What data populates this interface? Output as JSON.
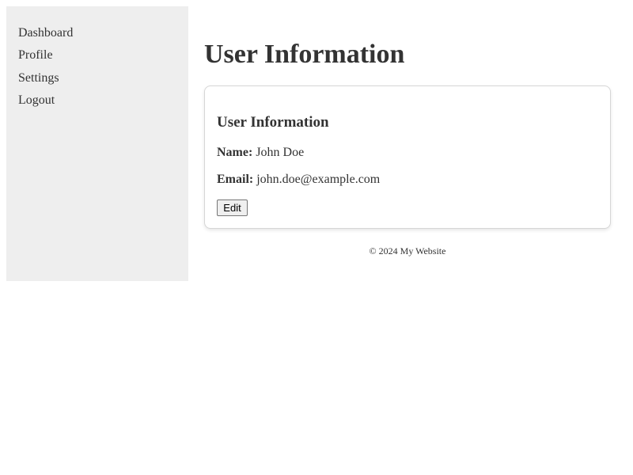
{
  "sidebar": {
    "items": [
      {
        "label": "Dashboard"
      },
      {
        "label": "Profile"
      },
      {
        "label": "Settings"
      },
      {
        "label": "Logout"
      }
    ]
  },
  "main": {
    "title": "User Information",
    "card": {
      "title": "User Information",
      "fields": [
        {
          "label": "Name:",
          "value": "John Doe"
        },
        {
          "label": "Email:",
          "value": "john.doe@example.com"
        }
      ],
      "edit_label": "Edit"
    },
    "footer": "© 2024 My Website"
  },
  "colors": {
    "sidebar_bg": "#eeeeee",
    "text": "#333333",
    "card_border": "#d6d6d6"
  }
}
